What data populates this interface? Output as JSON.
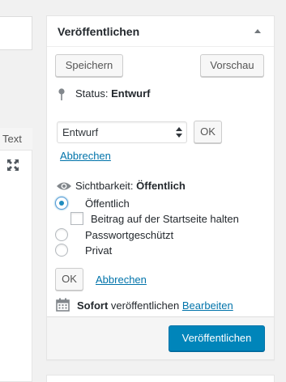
{
  "editor": {
    "text_tab": "Text",
    "fullscreen_icon": "fullscreen-icon"
  },
  "publish_box": {
    "title": "Veröffentlichen",
    "toggle_icon": "collapse-arrow-icon",
    "save_label": "Speichern",
    "preview_label": "Vorschau",
    "status": {
      "label": "Status:",
      "value": "Entwurf",
      "select_value": "Entwurf",
      "ok_label": "OK",
      "cancel_label": "Abbrechen"
    },
    "visibility": {
      "label": "Sichtbarkeit:",
      "value": "Öffentlich",
      "options": [
        {
          "label": "Öffentlich",
          "checked": true
        },
        {
          "label": "Passwortgeschützt",
          "checked": false
        },
        {
          "label": "Privat",
          "checked": false
        }
      ],
      "sticky_label": "Beitrag auf der Startseite halten",
      "sticky_checked": false,
      "ok_label": "OK",
      "cancel_label": "Abbrechen"
    },
    "schedule": {
      "strong": "Sofort",
      "text": "veröffentlichen",
      "edit_label": "Bearbeiten"
    },
    "publish_label": "Veröffentlichen"
  },
  "colors": {
    "accent": "#0085ba",
    "link": "#0073aa",
    "background": "#f1f1f1"
  }
}
